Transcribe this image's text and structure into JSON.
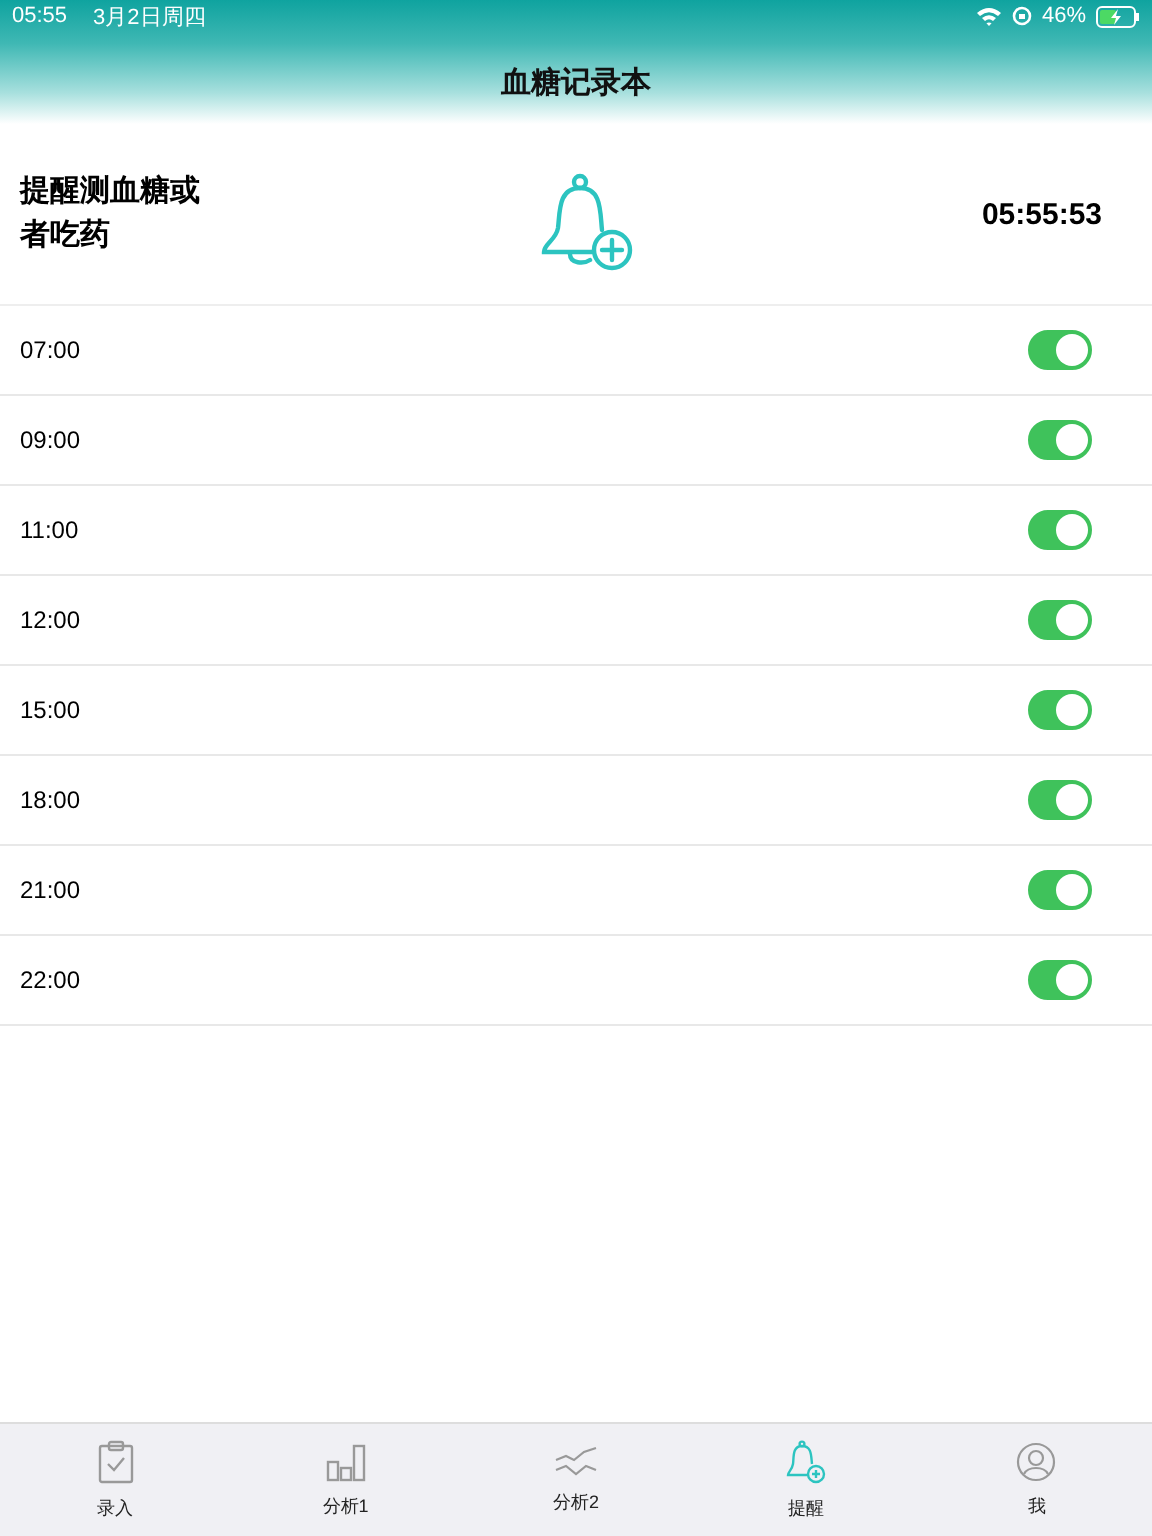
{
  "status_bar": {
    "time": "05:55",
    "date": "3月2日周四",
    "battery": "46%"
  },
  "nav": {
    "title": "血糖记录本"
  },
  "reminder_header": {
    "label": "提醒测血糖或者吃药",
    "clock": "05:55:53"
  },
  "reminders": [
    {
      "time": "07:00",
      "on": true
    },
    {
      "time": "09:00",
      "on": true
    },
    {
      "time": "11:00",
      "on": true
    },
    {
      "time": "12:00",
      "on": true
    },
    {
      "time": "15:00",
      "on": true
    },
    {
      "time": "18:00",
      "on": true
    },
    {
      "time": "21:00",
      "on": true
    },
    {
      "time": "22:00",
      "on": true
    }
  ],
  "tabs": [
    {
      "label": "录入",
      "kind": "clipboard",
      "selected": false
    },
    {
      "label": "分析1",
      "kind": "bars",
      "selected": false
    },
    {
      "label": "分析2",
      "kind": "lines",
      "selected": false
    },
    {
      "label": "提醒",
      "kind": "bell",
      "selected": true
    },
    {
      "label": "我",
      "kind": "person",
      "selected": false
    }
  ]
}
